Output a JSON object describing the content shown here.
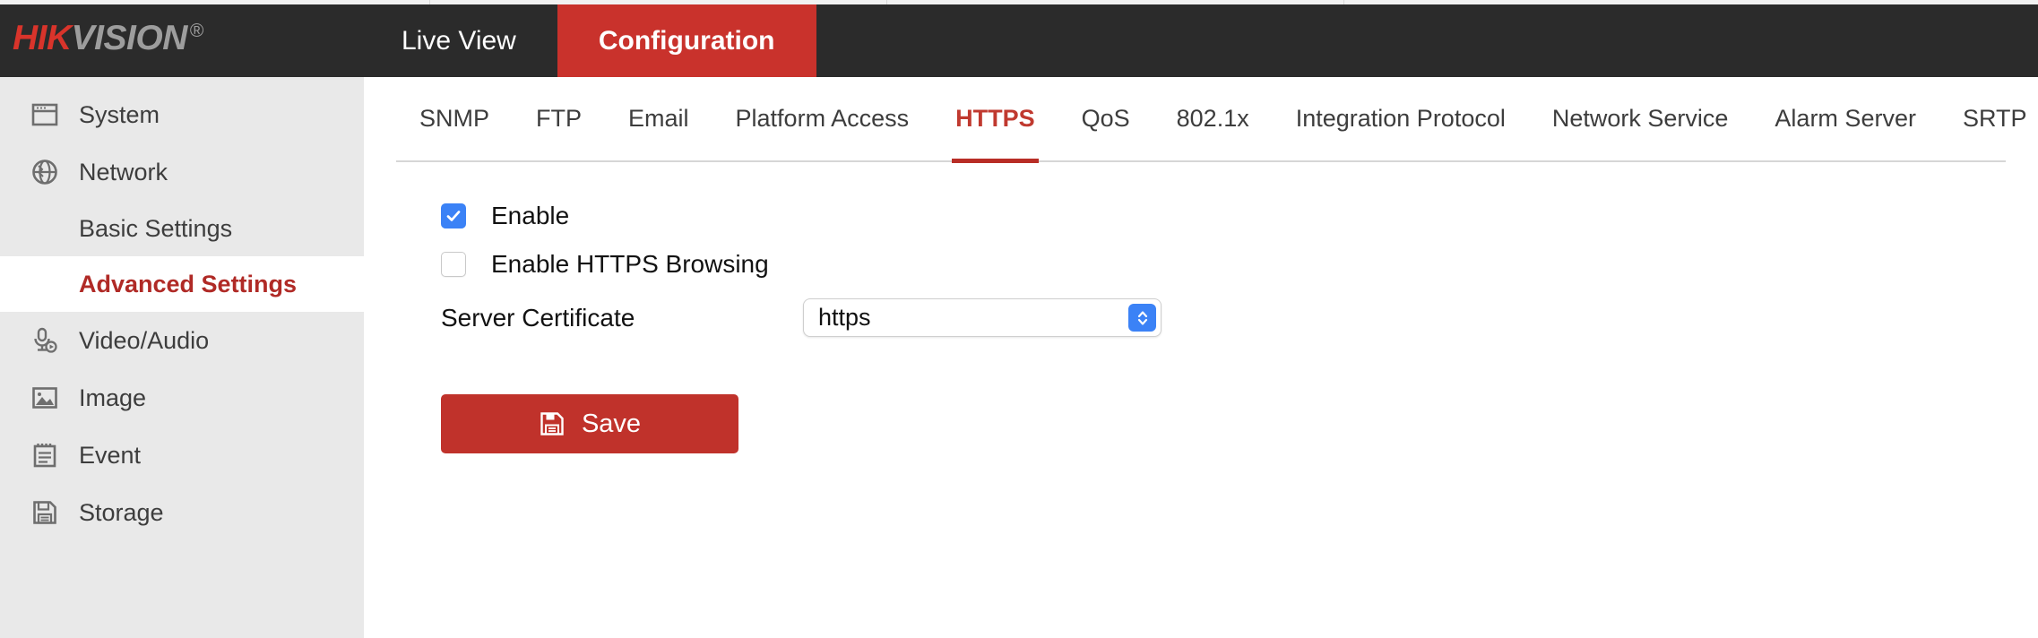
{
  "brand": {
    "logo_hik": "HIK",
    "logo_vision": "VISION",
    "logo_registered": "®"
  },
  "topnav": {
    "tabs": [
      {
        "label": "Live View",
        "active": false
      },
      {
        "label": "Configuration",
        "active": true
      }
    ]
  },
  "sidebar": {
    "items": [
      {
        "label": "System",
        "icon": "window-icon"
      },
      {
        "label": "Network",
        "icon": "globe-icon"
      },
      {
        "label": "Video/Audio",
        "icon": "video-audio-icon"
      },
      {
        "label": "Image",
        "icon": "image-icon"
      },
      {
        "label": "Event",
        "icon": "event-icon"
      },
      {
        "label": "Storage",
        "icon": "storage-icon"
      }
    ],
    "subitems": [
      {
        "label": "Basic Settings",
        "active": false
      },
      {
        "label": "Advanced Settings",
        "active": true
      }
    ]
  },
  "content": {
    "tabs": [
      {
        "label": "SNMP",
        "active": false
      },
      {
        "label": "FTP",
        "active": false
      },
      {
        "label": "Email",
        "active": false
      },
      {
        "label": "Platform Access",
        "active": false
      },
      {
        "label": "HTTPS",
        "active": true
      },
      {
        "label": "QoS",
        "active": false
      },
      {
        "label": "802.1x",
        "active": false
      },
      {
        "label": "Integration Protocol",
        "active": false
      },
      {
        "label": "Network Service",
        "active": false
      },
      {
        "label": "Alarm Server",
        "active": false
      },
      {
        "label": "SRTP",
        "active": false
      }
    ],
    "form": {
      "enable_label": "Enable",
      "enable_checked": true,
      "https_browsing_label": "Enable HTTPS Browsing",
      "https_browsing_checked": false,
      "server_certificate_label": "Server Certificate",
      "server_certificate_value": "https",
      "save_label": "Save"
    }
  },
  "colors": {
    "brand_red": "#c9322c",
    "header_dark": "#2b2b2b",
    "sidebar_gray": "#e9e9e9",
    "active_tab_red": "#c0392f",
    "checkbox_blue": "#3b82f6",
    "save_red": "#c0322b"
  }
}
